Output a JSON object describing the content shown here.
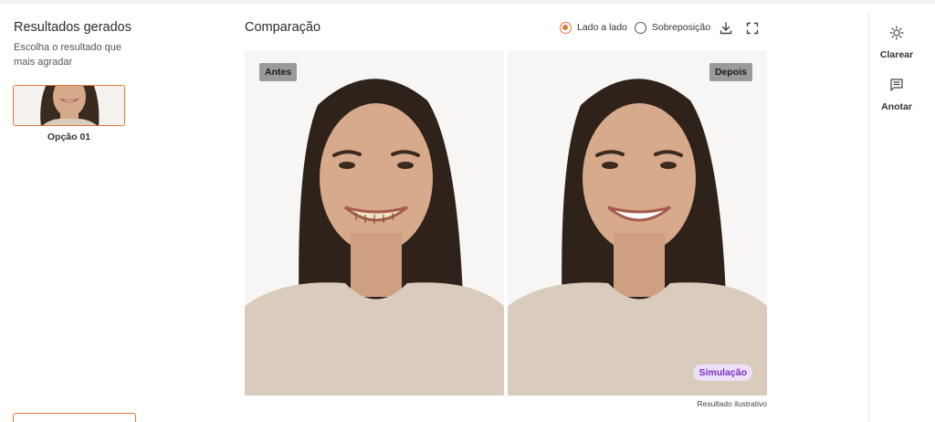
{
  "sidebar": {
    "title": "Resultados gerados",
    "subtitle": "Escolha o resultado que mais agradar",
    "options": [
      {
        "label": "Opção 01",
        "selected": true
      }
    ]
  },
  "comparison": {
    "title": "Comparação",
    "view_modes": [
      {
        "label": "Lado a lado",
        "selected": true
      },
      {
        "label": "Sobreposição",
        "selected": false
      }
    ],
    "download_icon": "download-icon",
    "fullscreen_icon": "fullscreen-icon",
    "before_label": "Antes",
    "after_label": "Depois",
    "simulation_tag": "Simulação",
    "caption": "Resultado ilustrativo"
  },
  "tools": {
    "brighten": {
      "label": "Clarear",
      "icon": "sun-icon"
    },
    "annotate": {
      "label": "Anotar",
      "icon": "note-icon"
    }
  },
  "colors": {
    "accent": "#e07a3c",
    "simulation_tag_bg": "#ecdff8",
    "simulation_tag_text": "#7b2fc4",
    "badge_bg": "#9a9a9a"
  }
}
